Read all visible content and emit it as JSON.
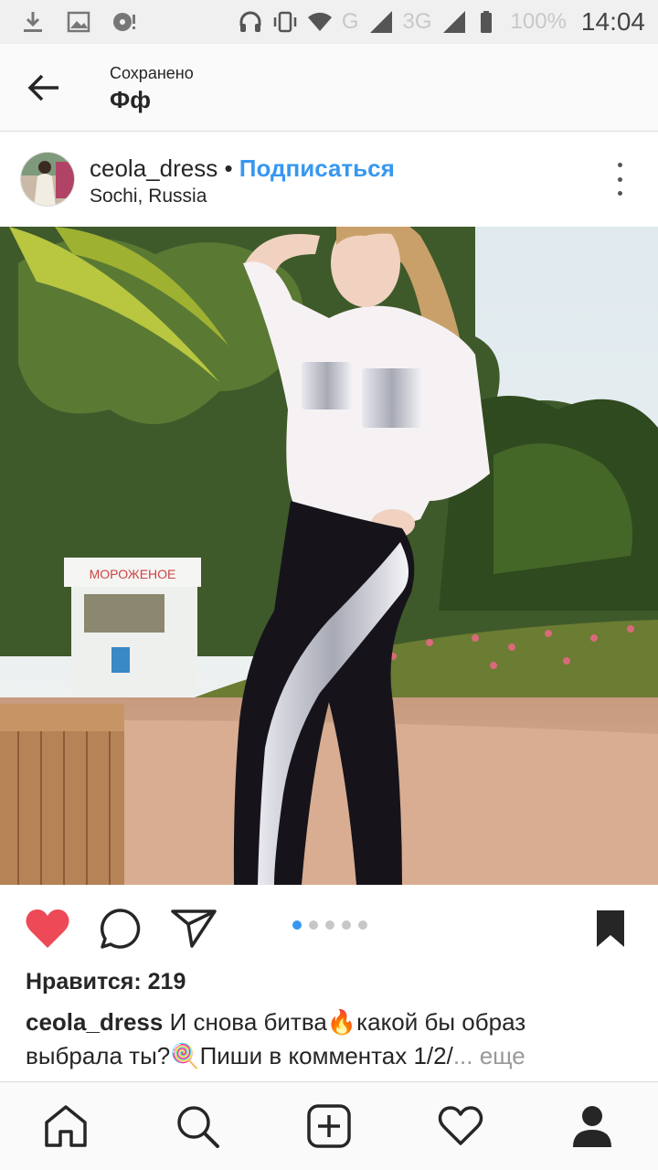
{
  "status_bar": {
    "network_g": "G",
    "network_3g": "3G",
    "battery": "100%",
    "time": "14:04"
  },
  "header": {
    "subtitle": "Сохранено",
    "title": "Фф",
    "back_icon": "arrow-left-icon"
  },
  "post": {
    "username": "ceola_dress",
    "separator": "•",
    "follow_label": "Подписаться",
    "location": "Sochi, Russia",
    "kiosk_sign": "МОРОЖЕНОЕ",
    "carousel": {
      "count": 5,
      "active_index": 0
    },
    "likes_text": "Нравится: 219",
    "caption_user": "ceola_dress",
    "caption_text": "И снова битва🔥какой бы образ выбрала ты?🍭Пиши в комментах 1/2/",
    "caption_more": "... еще"
  },
  "colors": {
    "accent_blue": "#3897f0",
    "like_red": "#ed4956",
    "text_dark": "#262626"
  },
  "nav": {
    "items": [
      "home-icon",
      "search-icon",
      "new-post-icon",
      "activity-heart-icon",
      "profile-icon"
    ]
  }
}
